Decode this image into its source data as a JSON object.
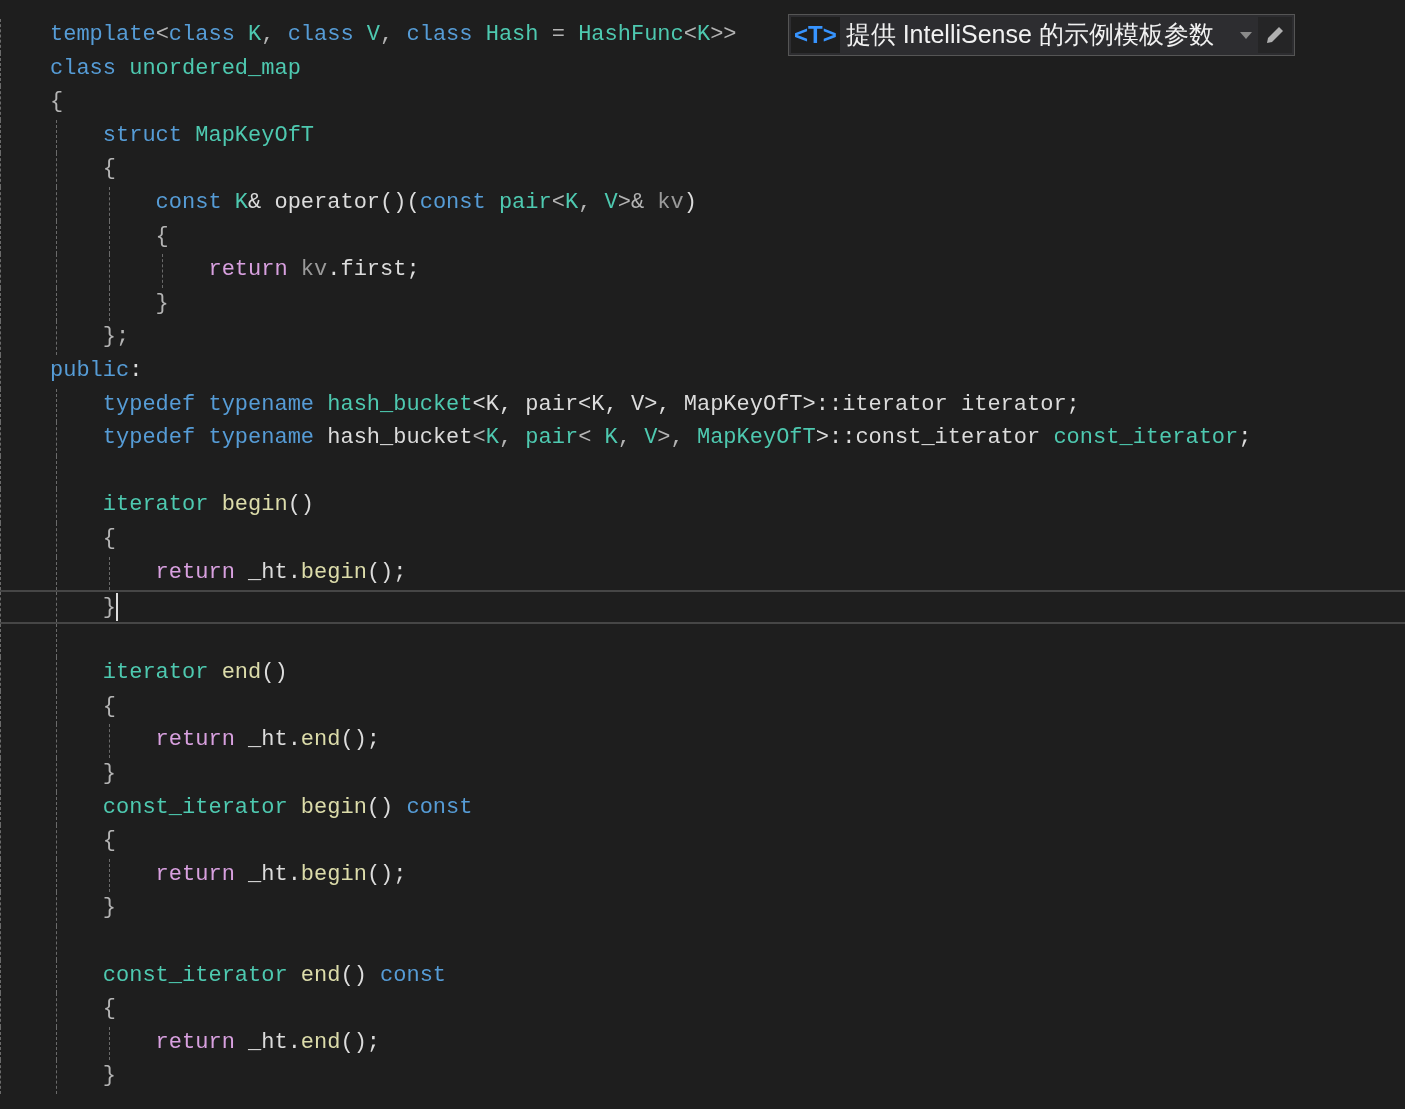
{
  "template_bar": {
    "badge": "<T>",
    "text": "提供 IntelliSense 的示例模板参数"
  },
  "lines": [
    {
      "selected": false,
      "tokens": [
        {
          "text": "template",
          "kind": "kw"
        },
        {
          "text": "<",
          "kind": "punct"
        },
        {
          "text": "class",
          "kind": "kw"
        },
        {
          "text": " K",
          "kind": "type"
        },
        {
          "text": ", ",
          "kind": "punct"
        },
        {
          "text": "class",
          "kind": "kw"
        },
        {
          "text": " V",
          "kind": "type"
        },
        {
          "text": ", ",
          "kind": "punct"
        },
        {
          "text": "class",
          "kind": "kw"
        },
        {
          "text": " Hash",
          "kind": "type"
        },
        {
          "text": " = ",
          "kind": "punct"
        },
        {
          "text": "HashFunc",
          "kind": "type"
        },
        {
          "text": "<",
          "kind": "punct"
        },
        {
          "text": "K",
          "kind": "type"
        },
        {
          "text": ">>",
          "kind": "punct"
        }
      ]
    },
    {
      "selected": false,
      "tokens": [
        {
          "text": "class",
          "kind": "kw"
        },
        {
          "text": " unordered_map",
          "kind": "type"
        }
      ]
    },
    {
      "selected": false,
      "tokens": [
        {
          "text": "{",
          "kind": "brace"
        }
      ]
    },
    {
      "selected": false,
      "tokens": [
        {
          "text": "    struct",
          "kind": "kw"
        },
        {
          "text": " MapKeyOfT",
          "kind": "type"
        }
      ]
    },
    {
      "selected": false,
      "tokens": [
        {
          "text": "    {",
          "kind": "brace"
        }
      ]
    },
    {
      "selected": false,
      "tokens": [
        {
          "text": "        const",
          "kind": "kw"
        },
        {
          "text": " K",
          "kind": "type"
        },
        {
          "text": "& operator()(",
          "kind": "plain"
        },
        {
          "text": "const",
          "kind": "kw"
        },
        {
          "text": " pair",
          "kind": "type"
        },
        {
          "text": "<",
          "kind": "punct"
        },
        {
          "text": "K",
          "kind": "type"
        },
        {
          "text": ", ",
          "kind": "punct"
        },
        {
          "text": "V",
          "kind": "type"
        },
        {
          "text": ">& ",
          "kind": "punct"
        },
        {
          "text": "kv",
          "kind": "param"
        },
        {
          "text": ")",
          "kind": "plain"
        }
      ]
    },
    {
      "selected": false,
      "tokens": [
        {
          "text": "        {",
          "kind": "brace"
        }
      ]
    },
    {
      "selected": false,
      "tokens": [
        {
          "text": "            return",
          "kind": "ctrl"
        },
        {
          "text": " kv",
          "kind": "param"
        },
        {
          "text": ".first;",
          "kind": "plain"
        }
      ]
    },
    {
      "selected": false,
      "tokens": [
        {
          "text": "        }",
          "kind": "brace"
        }
      ]
    },
    {
      "selected": false,
      "tokens": [
        {
          "text": "    };",
          "kind": "brace"
        }
      ]
    },
    {
      "selected": false,
      "tokens": [
        {
          "text": "public",
          "kind": "kw"
        },
        {
          "text": ":",
          "kind": "plain"
        }
      ]
    },
    {
      "selected": false,
      "tokens": [
        {
          "text": "    typedef",
          "kind": "kw"
        },
        {
          "text": " typename",
          "kind": "kw"
        },
        {
          "text": " hash_bucket",
          "kind": "type"
        },
        {
          "text": "<K, pair<K, V>, MapKeyOfT>::iterator iterator;",
          "kind": "plain"
        }
      ]
    },
    {
      "selected": false,
      "tokens": [
        {
          "text": "    typedef",
          "kind": "kw"
        },
        {
          "text": " typename",
          "kind": "kw"
        },
        {
          "text": " hash_bucket",
          "kind": "plain"
        },
        {
          "text": "<",
          "kind": "punct"
        },
        {
          "text": "K",
          "kind": "type"
        },
        {
          "text": ", ",
          "kind": "punct"
        },
        {
          "text": "pair",
          "kind": "type"
        },
        {
          "text": "< ",
          "kind": "punct"
        },
        {
          "text": "K",
          "kind": "type"
        },
        {
          "text": ", ",
          "kind": "punct"
        },
        {
          "text": "V",
          "kind": "type"
        },
        {
          "text": ">, ",
          "kind": "punct"
        },
        {
          "text": "MapKeyOfT",
          "kind": "type"
        },
        {
          "text": ">::const_iterator ",
          "kind": "plain"
        },
        {
          "text": "const_iterator",
          "kind": "type"
        },
        {
          "text": ";",
          "kind": "plain"
        }
      ]
    },
    {
      "selected": false
    },
    {
      "selected": false,
      "tokens": [
        {
          "text": "    iterator",
          "kind": "type"
        },
        {
          "text": " begin",
          "kind": "fn"
        },
        {
          "text": "()",
          "kind": "plain"
        }
      ]
    },
    {
      "selected": false,
      "tokens": [
        {
          "text": "    {",
          "kind": "brace"
        }
      ]
    },
    {
      "selected": false,
      "tokens": [
        {
          "text": "        return",
          "kind": "ctrl"
        },
        {
          "text": " _ht.",
          "kind": "plain"
        },
        {
          "text": "begin",
          "kind": "fn"
        },
        {
          "text": "();",
          "kind": "plain"
        }
      ]
    },
    {
      "selected": true,
      "tokens": [
        {
          "text": "    }",
          "kind": "brace"
        }
      ]
    },
    {
      "selected": false
    },
    {
      "selected": false,
      "tokens": [
        {
          "text": "    iterator",
          "kind": "type"
        },
        {
          "text": " end",
          "kind": "fn"
        },
        {
          "text": "()",
          "kind": "plain"
        }
      ]
    },
    {
      "selected": false,
      "tokens": [
        {
          "text": "    {",
          "kind": "brace"
        }
      ]
    },
    {
      "selected": false,
      "tokens": [
        {
          "text": "        return",
          "kind": "ctrl"
        },
        {
          "text": " _ht.",
          "kind": "plain"
        },
        {
          "text": "end",
          "kind": "fn"
        },
        {
          "text": "();",
          "kind": "plain"
        }
      ]
    },
    {
      "selected": false,
      "tokens": [
        {
          "text": "    }",
          "kind": "brace"
        }
      ]
    },
    {
      "selected": false,
      "tokens": [
        {
          "text": "    const_iterator",
          "kind": "type"
        },
        {
          "text": " begin",
          "kind": "fn"
        },
        {
          "text": "() ",
          "kind": "plain"
        },
        {
          "text": "const",
          "kind": "kw"
        }
      ]
    },
    {
      "selected": false,
      "tokens": [
        {
          "text": "    {",
          "kind": "brace"
        }
      ]
    },
    {
      "selected": false,
      "tokens": [
        {
          "text": "        return",
          "kind": "ctrl"
        },
        {
          "text": " _ht.",
          "kind": "plain"
        },
        {
          "text": "begin",
          "kind": "fn"
        },
        {
          "text": "();",
          "kind": "plain"
        }
      ]
    },
    {
      "selected": false,
      "tokens": [
        {
          "text": "    }",
          "kind": "brace"
        }
      ]
    },
    {
      "selected": false
    },
    {
      "selected": false,
      "tokens": [
        {
          "text": "    const_iterator",
          "kind": "type"
        },
        {
          "text": " end",
          "kind": "fn"
        },
        {
          "text": "() ",
          "kind": "plain"
        },
        {
          "text": "const",
          "kind": "kw"
        }
      ]
    },
    {
      "selected": false,
      "tokens": [
        {
          "text": "    {",
          "kind": "brace"
        }
      ]
    },
    {
      "selected": false,
      "tokens": [
        {
          "text": "        return",
          "kind": "ctrl"
        },
        {
          "text": " _ht.",
          "kind": "plain"
        },
        {
          "text": "end",
          "kind": "fn"
        },
        {
          "text": "();",
          "kind": "plain"
        }
      ]
    },
    {
      "selected": false,
      "tokens": [
        {
          "text": "    }",
          "kind": "brace"
        }
      ]
    }
  ]
}
